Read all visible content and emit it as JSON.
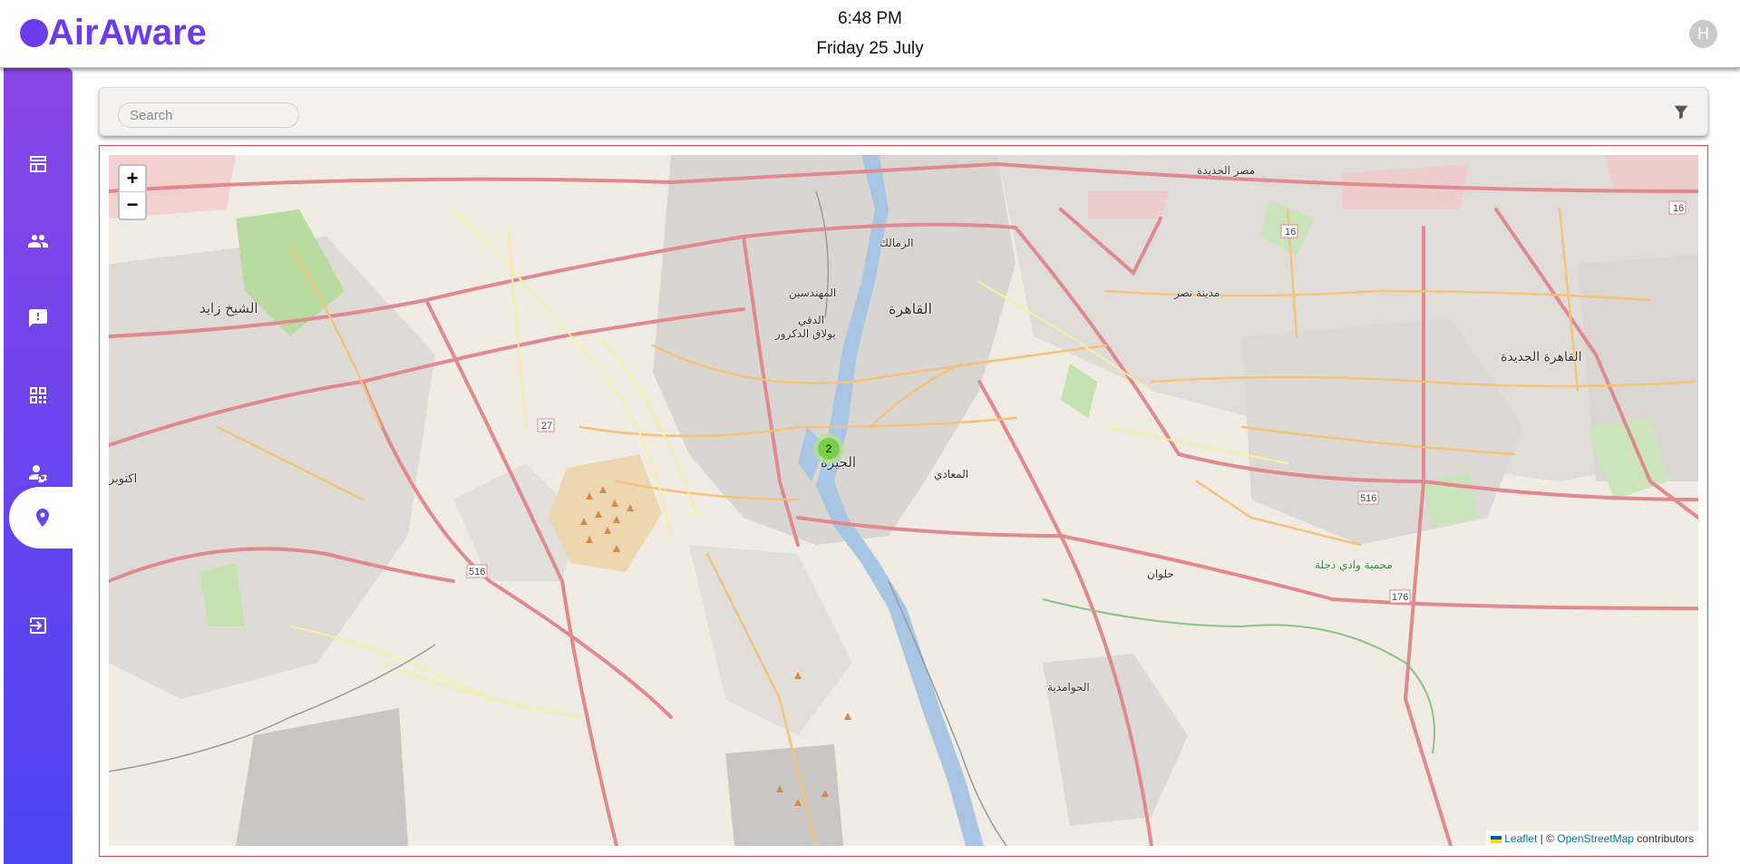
{
  "header": {
    "app_name": "AirAware",
    "time": "6:48 PM",
    "date": "Friday 25 July",
    "avatar_initial": "H"
  },
  "sidebar": {
    "items": [
      {
        "icon": "dashboard-icon",
        "active": false
      },
      {
        "icon": "users-icon",
        "active": false
      },
      {
        "icon": "feedback-icon",
        "active": false
      },
      {
        "icon": "widgets-icon",
        "active": false
      },
      {
        "icon": "user-settings-icon",
        "active": false
      },
      {
        "icon": "location-pin-icon",
        "active": true
      },
      {
        "icon": "logout-icon",
        "active": false
      }
    ]
  },
  "filters": {
    "search_placeholder": "Search",
    "filter_icon": "filter-icon"
  },
  "map": {
    "zoom_in": "+",
    "zoom_out": "−",
    "cluster_count": "2",
    "attribution_leaflet": "Leaflet",
    "attribution_separator": " | © ",
    "attribution_osm": "OpenStreetMap",
    "attribution_suffix": " contributors",
    "labels": [
      "الشيخ زايد",
      "القاهرة",
      "الجيزة",
      "القاهرة الجديدة",
      "مدينة نصر",
      "المعادي",
      "حلوان",
      "الدقي",
      "المهندسين",
      "بولاق الدكرور",
      "محمية وادي دجلة",
      "الزمالك",
      "مصر الجديدة",
      "الحوامدية",
      "اكتوبر"
    ]
  },
  "colors": {
    "accent": "#6d3ce8",
    "sidebar_top": "#8a46e6",
    "sidebar_bottom": "#4d44f2",
    "map_border": "#e8434a",
    "cluster": "#6ecc39"
  }
}
